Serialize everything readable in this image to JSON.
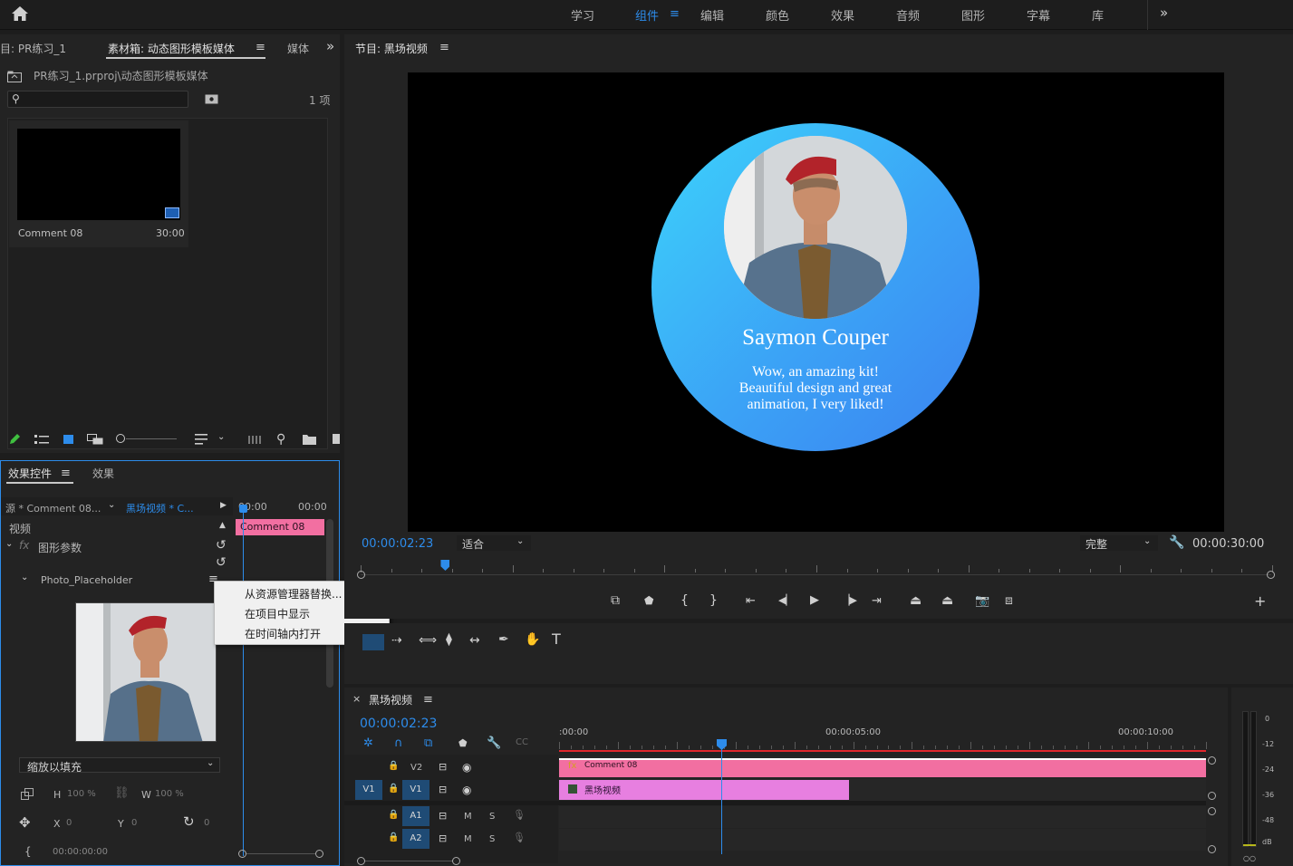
{
  "workspace": {
    "items": [
      "学习",
      "组件",
      "编辑",
      "颜色",
      "效果",
      "音频",
      "图形",
      "字幕",
      "库"
    ],
    "active_index": 1
  },
  "project_panel": {
    "tabs": [
      "目: PR练习_1",
      "素材箱: 动态图形模板媒体",
      "媒体"
    ],
    "path": "PR练习_1.prproj\\动态图形模板媒体",
    "item_count": "1 项",
    "clip": {
      "name": "Comment 08",
      "duration": "30:00"
    }
  },
  "effect_panel": {
    "tabs": [
      "效果控件",
      "效果"
    ],
    "source": "源 * Comment 08...",
    "sequence_link": "黑场视频 * C...",
    "ruler_times": [
      "00:00",
      "00:00"
    ],
    "clip_label": "Comment 08",
    "video_label": "视频",
    "fx_group": "图形参数",
    "param_name": "Photo_Placeholder",
    "scale_mode": "缩放以填充",
    "h_label": "H",
    "h_value": "100 %",
    "w_label": "W",
    "w_value": "100 %",
    "x_label": "X",
    "x_value": "0",
    "y_label": "Y",
    "y_value": "0",
    "rot_value": "0",
    "time_value": "00:00:00:00"
  },
  "context_menu": {
    "items": [
      "从资源管理器替换...",
      "在项目中显示",
      "在时间轴内打开"
    ]
  },
  "program_monitor": {
    "title": "节目: 黑场视频",
    "timecode": "00:00:02:23",
    "fit": "适合",
    "quality": "完整",
    "duration": "00:00:30:00",
    "playhead_fraction": 0.093
  },
  "preview": {
    "name": "Saymon Couper",
    "quote": "Wow, an amazing kit! Beautiful design and great animation, I very liked!",
    "bg_color": "#000000",
    "card_gradient_start": "#3dd3fb",
    "card_gradient_end": "#3b82f0"
  },
  "timeline": {
    "title": "黑场视频",
    "timecode": "00:00:02:23",
    "ruler": [
      ":00:00",
      "00:00:05:00",
      "00:00:10:00"
    ],
    "tracks": {
      "v2": "V2",
      "v1": "V1",
      "src_v1": "V1",
      "a1": "A1",
      "a2": "A2",
      "m": "M",
      "s": "S"
    },
    "clips": [
      {
        "name": "Comment 08",
        "track": "V2",
        "color": "#f26fa1"
      },
      {
        "name": "黑场视频",
        "track": "V1",
        "color": "#e77fe0"
      }
    ]
  },
  "audio_meter": {
    "labels": [
      "0",
      "-12",
      "-24",
      "-36",
      "-48",
      "dB"
    ]
  },
  "colors": {
    "accent": "#2d8ceb",
    "panel_bg": "#232323",
    "app_bg": "#1d1d1d",
    "clip_pink": "#f26fa1",
    "clip_violet": "#e77fe0"
  }
}
